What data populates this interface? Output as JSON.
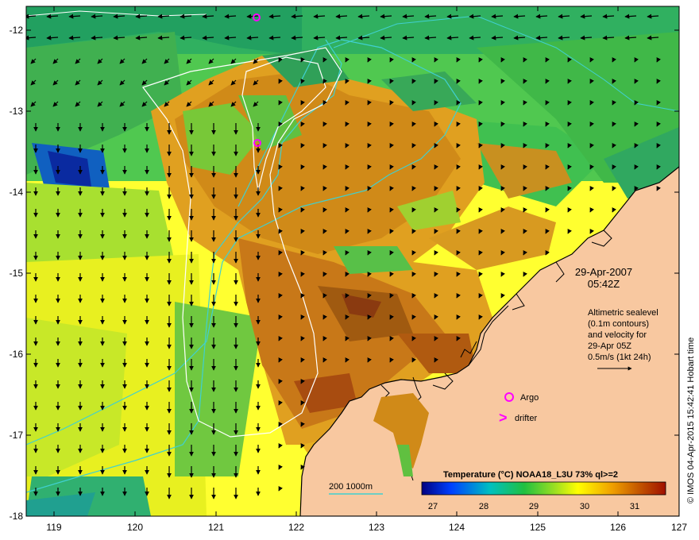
{
  "map": {
    "date_line1": "29-Apr-2007",
    "date_line2": "05:42Z",
    "annotation_lines": [
      "Altimetric sealevel",
      "(0.1m contours)",
      "and velocity for",
      "29-Apr 05Z",
      "0.5m/s (1kt 24h)"
    ],
    "legend_argo": "Argo",
    "legend_drifter": "drifter",
    "drifter_symbol": ">",
    "isobath_label": "200  1000m",
    "credit": "© IMOS 04-Apr-2015 15:42:41 Hobart time",
    "colorbar_title": "Temperature (°C) NOAA18_L3U 73% ql>=2",
    "colorbar_ticks": [
      "27",
      "28",
      "29",
      "30",
      "31"
    ],
    "x_ticks": [
      "119",
      "120",
      "121",
      "122",
      "123",
      "124",
      "125",
      "126",
      "127"
    ],
    "y_ticks": [
      "-12",
      "-13",
      "-14",
      "-15",
      "-16",
      "-17",
      "-18"
    ],
    "colors": {
      "land": "#f8c8a0",
      "coast": "#000000",
      "isobath": "#40d0d0",
      "sealevel_contour": "#ffffff",
      "argo": "#ff00ff",
      "drifter": "#ff00ff"
    }
  }
}
